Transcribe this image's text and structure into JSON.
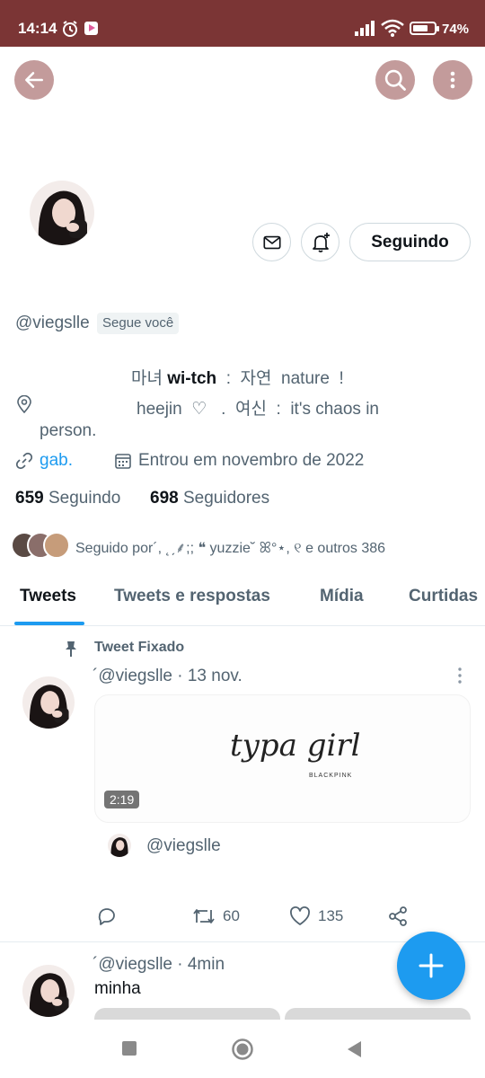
{
  "status_bar": {
    "time": "14:14",
    "battery_percent": 74,
    "battery_label": "74%"
  },
  "header": {
    "back_icon": "arrow-left-icon",
    "search_icon": "search-icon",
    "more_icon": "more-vertical-icon"
  },
  "profile": {
    "handle": "@viegslle",
    "follows_you": "Segue você",
    "bio_line1_a": "마녀 ",
    "bio_line1_b": "wi-tch",
    "bio_line1_c": "  :  자연  nature  !",
    "bio_line2": "heejin  ♡   .  여신  :  it's chaos in",
    "bio_line3": "person.",
    "link": "gab.",
    "joined": "Entrou em novembro de 2022",
    "following_count": "659",
    "following_label": "Seguindo",
    "followers_count": "698",
    "followers_label": "Seguidores",
    "followed_by": "Seguido por´, ˛ˏ⸙;; ❝ yuzzie˘ ꕤ°⋆, ୧ e outros 386"
  },
  "actions": {
    "message_icon": "mail-icon",
    "notify_icon": "bell-plus-icon",
    "follow_label": "Seguindo"
  },
  "tabs": [
    {
      "label": "Tweets",
      "active": true
    },
    {
      "label": "Tweets e respostas",
      "active": false
    },
    {
      "label": "Mídia",
      "active": false
    },
    {
      "label": "Curtidas",
      "active": false
    }
  ],
  "pinned_tweet": {
    "pinned_label": "Tweet Fixado",
    "header": "´@viegslle · 13 nov.",
    "media_title": "typa girl",
    "media_subtitle": "BLACKPINK",
    "duration": "2:19",
    "quoted_handle": "@viegslle",
    "retweets": "60",
    "likes": "135"
  },
  "second_tweet": {
    "header": "´@viegslle · 4min",
    "text": "minha"
  },
  "colors": {
    "status_bar": "#7b3535",
    "header_buttons": "#c39b9b",
    "accent": "#1d9bf0"
  }
}
